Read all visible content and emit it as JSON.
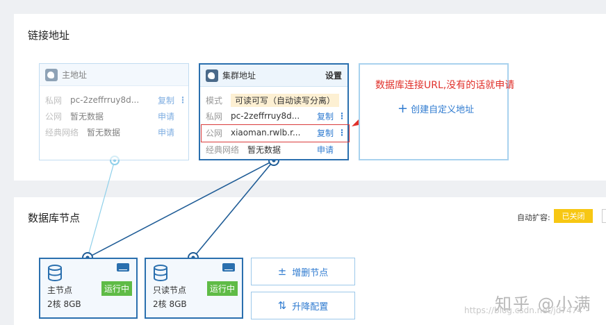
{
  "sections": {
    "link_address": "链接地址",
    "db_nodes": "数据库节点"
  },
  "primary_card": {
    "title": "主地址",
    "rows": [
      {
        "key": "私网",
        "value": "pc-2zeffrruy8d...",
        "action": "复制",
        "more": "⋮"
      },
      {
        "key": "公网",
        "value": "暂无数据",
        "action": "申请"
      },
      {
        "key": "经典网络",
        "value": "暂无数据",
        "action": "申请"
      }
    ]
  },
  "cluster_card": {
    "title": "集群地址",
    "settings": "设置",
    "mode_key": "模式",
    "mode_value": "可读可写（自动读写分离）",
    "rows": [
      {
        "key": "私网",
        "value": "pc-2zeffrruy8d...",
        "action": "复制",
        "more": "⋮"
      },
      {
        "key": "公网",
        "value": "xiaoman.rwlb.r...",
        "action": "复制",
        "more": "⋮"
      },
      {
        "key": "经典网络",
        "value": "暂无数据",
        "action": "申请"
      }
    ]
  },
  "create_custom": {
    "plus": "+",
    "label": "创建自定义地址"
  },
  "annotation": "数据库连接URL,没有的话就申请",
  "auto_scale": {
    "label": "自动扩容:",
    "button": "已关闭"
  },
  "nodes": [
    {
      "name": "主节点",
      "spec": "2核 8GB",
      "status": "运行中"
    },
    {
      "name": "只读节点",
      "spec": "2核 8GB",
      "status": "运行中"
    }
  ],
  "ops": {
    "add_remove": "增删节点",
    "add_remove_icon": "±",
    "scale": "升降配置",
    "scale_icon": "⇅"
  },
  "watermark": "https://blog.csdn.net/jd7474",
  "zhihu": "知乎 @小满",
  "colors": {
    "accent_blue": "#2a6fae",
    "link_blue": "#2f7bd0",
    "running_green": "#5fbb46",
    "auto_yellow": "#f7c713",
    "annotation_red": "#e0302a"
  }
}
